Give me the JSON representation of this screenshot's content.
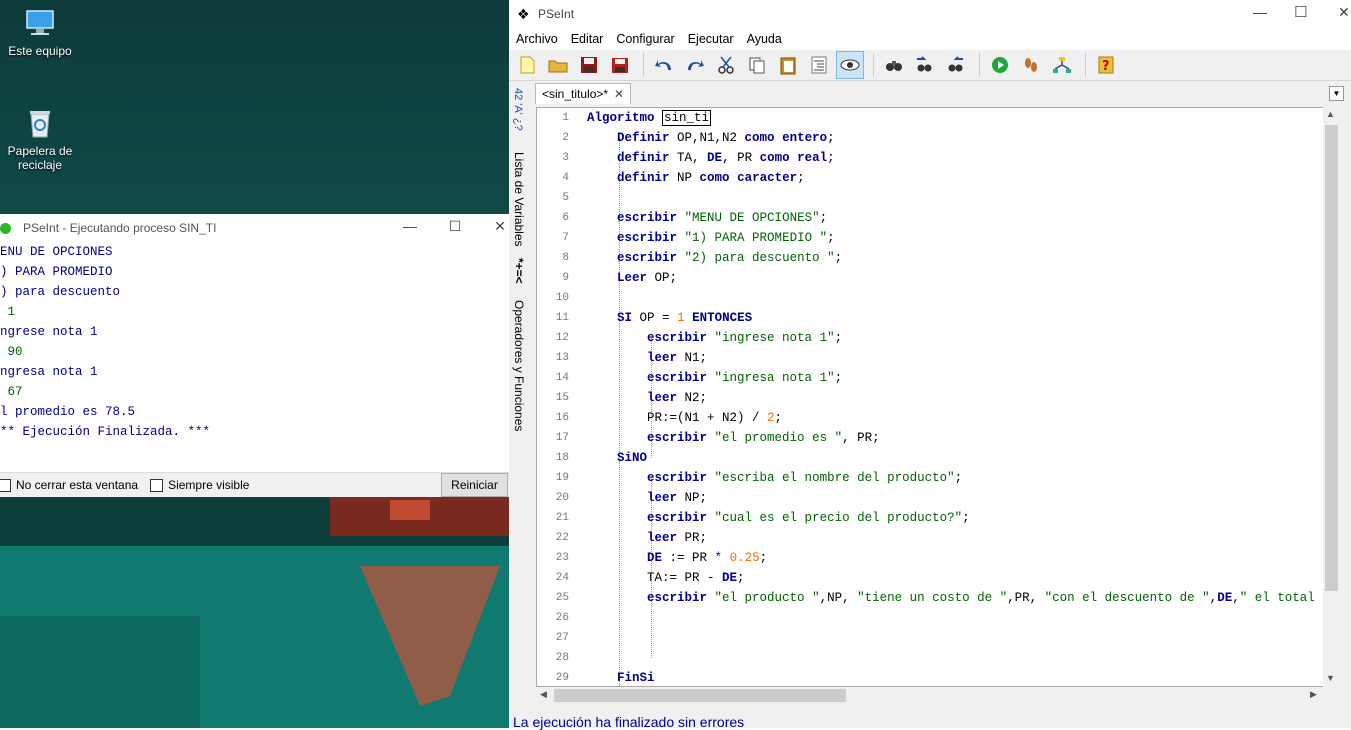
{
  "desktop": {
    "icons": [
      {
        "label": "Este equipo",
        "icon": "computer-icon"
      },
      {
        "label": "Papelera de reciclaje",
        "icon": "recycle-bin-icon"
      }
    ]
  },
  "console": {
    "title": "PSeInt - Ejecutando proceso SIN_TI",
    "lines": [
      "ENU DE OPCIONES",
      ") PARA PROMEDIO",
      ") para descuento",
      " 1",
      "ngrese nota 1",
      " 90",
      "ngresa nota 1",
      " 67",
      "l promedio es 78.5",
      "** Ejecución Finalizada. ***"
    ],
    "no_cerrar_label": "No cerrar esta ventana",
    "siempre_visible_label": "Siempre visible",
    "reiniciar_label": "Reiniciar"
  },
  "main": {
    "title": "PSeInt",
    "menu": [
      "Archivo",
      "Editar",
      "Configurar",
      "Ejecutar",
      "Ayuda"
    ],
    "side_tabs": {
      "variables": "Lista de Variables",
      "variables_icons": "42 'A' ¿?",
      "operadores": "Operadores y Funciones",
      "operadores_icons": "*+=<"
    },
    "tab_label": "<sin_titulo>*",
    "status": "La ejecución ha finalizado sin errores",
    "line_numbers": [
      "1",
      "2",
      "3",
      "4",
      "5",
      "6",
      "7",
      "8",
      "9",
      "10",
      "11",
      "12",
      "13",
      "14",
      "15",
      "16",
      "17",
      "18",
      "19",
      "20",
      "21",
      "22",
      "23",
      "24",
      "25",
      "26",
      "27",
      "28",
      "29"
    ],
    "code": [
      "Algoritmo sin_ti",
      "    Definir OP,N1,N2 como entero;",
      "    definir TA, DE, PR como real;",
      "    definir NP como caracter;",
      "",
      "    escribir \"MENU DE OPCIONES\";",
      "    escribir \"1) PARA PROMEDIO \";",
      "    escribir \"2) para descuento \";",
      "    Leer OP;",
      "",
      "    SI OP = 1 ENTONCES",
      "        escribir \"ingrese nota 1\";",
      "        leer N1;",
      "        escribir \"ingresa nota 1\";",
      "        leer N2;",
      "        PR:=(N1 + N2) / 2;",
      "        escribir \"el promedio es \", PR;",
      "    SiNO",
      "        escribir \"escriba el nombre del producto\";",
      "        leer NP;",
      "        escribir \"cual es el precio del producto?\";",
      "        leer PR;",
      "        DE := PR * 0.25;",
      "        TA:= PR - DE;",
      "        escribir \"el producto \",NP, \"tiene un costo de \",PR, \"con el descuento de \",DE,\" el total a pag",
      "",
      "",
      "",
      "    FinSi"
    ]
  }
}
